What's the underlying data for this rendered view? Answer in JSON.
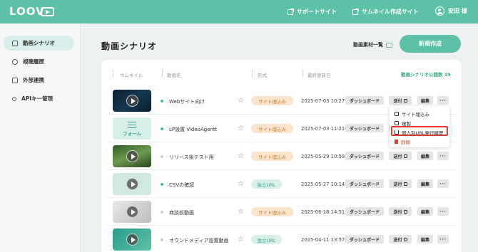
{
  "header": {
    "logo_text": "LOOV",
    "support_link": "サポートサイト",
    "thumbnail_link": "サムネイル作成サイト",
    "user_name": "安田 様"
  },
  "sidebar": {
    "items": [
      {
        "label": "動画シナリオ",
        "icon": "scenario-icon",
        "active": true
      },
      {
        "label": "視聴履歴",
        "icon": "user-history-icon",
        "active": false
      },
      {
        "label": "外部連携",
        "icon": "external-link-icon",
        "active": false
      },
      {
        "label": "APIキー管理",
        "icon": "key-icon",
        "active": false
      }
    ]
  },
  "main": {
    "title": "動画シナリオ",
    "materials_link": "動画素材一覧",
    "new_button": "新規作成",
    "columns": {
      "thumbnail": "サムネイル",
      "name": "動画名",
      "format": "形式",
      "updated": "最終更新日",
      "published_count": "動画シナリオ公開数 19"
    },
    "buttons": {
      "dashboard": "ダッシュボード",
      "send": "送付",
      "edit": "編集",
      "more": "···"
    },
    "form_thumb_label": "フォーム",
    "rows": [
      {
        "name": "Webサイト向け",
        "format": "サイト埋込み",
        "format_type": "embed",
        "date": "2025-07-03 10:27",
        "status": "green",
        "thumb": "dark"
      },
      {
        "name": "LP設置 VideoAgentt",
        "format": "サイト埋込み",
        "format_type": "embed",
        "date": "2025-07-03 11:21",
        "status": "green",
        "thumb": "form"
      },
      {
        "name": "リリース後テスト用",
        "format": "サイト埋込み",
        "format_type": "embed",
        "date": "2025-05-29 10:59",
        "status": "gray",
        "thumb": "forest"
      },
      {
        "name": "CSVの確認",
        "format": "独立URL",
        "format_type": "url",
        "date": "2025-05-27 10:14",
        "status": "green",
        "thumb": "mint"
      },
      {
        "name": "商談前動画",
        "format": "サイト埋込み",
        "format_type": "embed",
        "date": "2025-06-18 14:51",
        "status": "gray",
        "thumb": "light"
      },
      {
        "name": "オウンドメディア設置動画",
        "format": "独立URL",
        "format_type": "url",
        "date": "2025-04-11 13:57",
        "status": "gray",
        "thumb": "teal"
      }
    ]
  },
  "dropdown": {
    "items": [
      {
        "label": "サイト埋込み",
        "icon": "embed-icon"
      },
      {
        "label": "複製",
        "icon": "duplicate-icon"
      },
      {
        "label": "個人別URL発行履歴",
        "icon": "download-icon",
        "highlighted": true
      },
      {
        "label": "削除",
        "icon": "trash-icon",
        "danger": true
      }
    ]
  },
  "colors": {
    "brand": "#5cc1a6",
    "status_green": "#3ec28f",
    "status_gray": "#cccccc",
    "highlight": "#e0392f"
  }
}
